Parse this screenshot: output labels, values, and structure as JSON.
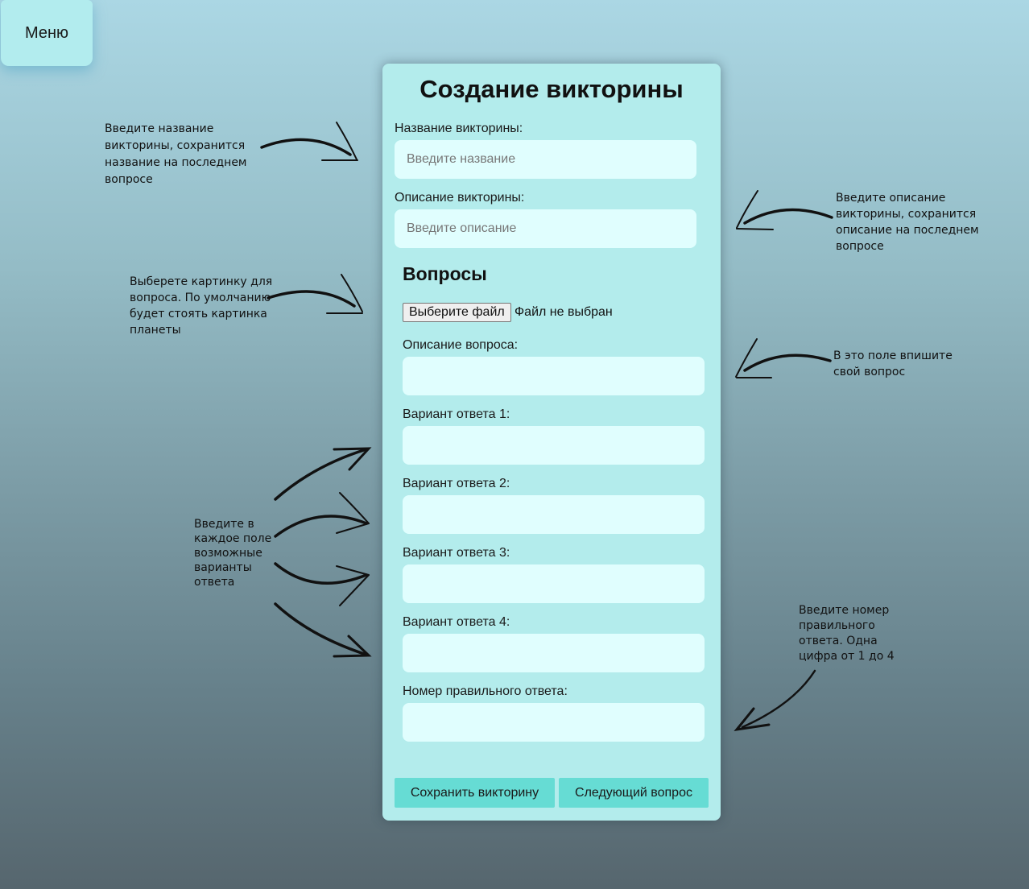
{
  "menu": {
    "label": "Меню"
  },
  "form": {
    "title": "Создание викторины",
    "name_label": "Название викторины:",
    "name_placeholder": "Введите название",
    "desc_label": "Описание викторины:",
    "desc_placeholder": "Введите описание",
    "questions_heading": "Вопросы",
    "file_button": "Выберите файл",
    "file_status": "Файл не выбран",
    "question_label": "Описание вопроса:",
    "answer1_label": "Вариант ответа 1:",
    "answer2_label": "Вариант ответа 2:",
    "answer3_label": "Вариант ответа 3:",
    "answer4_label": "Вариант ответа 4:",
    "correct_label": "Номер правильного ответа:",
    "save_button": "Сохранить викторину",
    "next_button": "Следующий вопрос"
  },
  "hints": {
    "name": [
      "Введите название",
      "викторины, сохранится",
      "название на последнем",
      "вопросе"
    ],
    "description": [
      "Введите описание",
      "викторины, сохранится",
      "описание на последнем",
      "вопросе"
    ],
    "image": [
      "Выберете картинку для",
      "вопроса. По умолчанию",
      "будет стоять картинка",
      "планеты"
    ],
    "question": [
      "В это поле впишите",
      "свой вопрос"
    ],
    "answers": [
      "Введите в",
      "каждое поле",
      "возможные",
      "варианты",
      "ответа"
    ],
    "correct": [
      "Введите номер",
      "правильного",
      "ответа. Одна",
      "цифра от 1 до 4"
    ]
  }
}
